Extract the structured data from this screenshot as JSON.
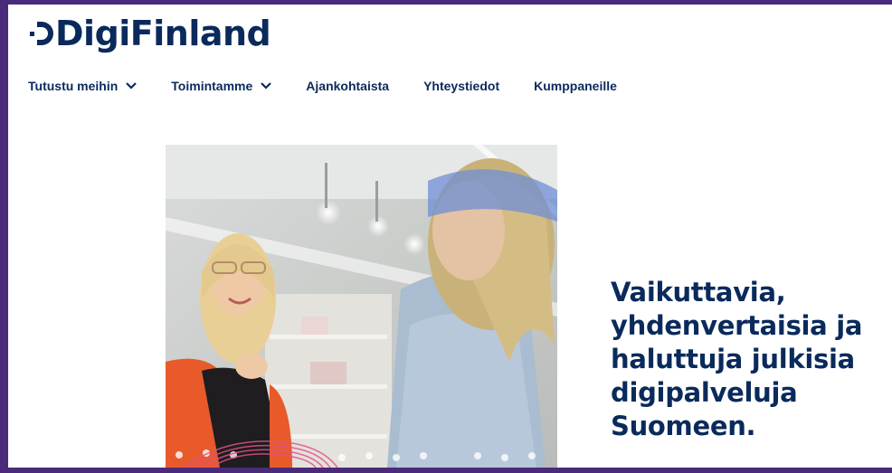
{
  "brand": {
    "name": "DigiFinland",
    "logo_icon": "digifinland-d-mark",
    "color": "#0a2a5c"
  },
  "nav": {
    "items": [
      {
        "label": "Tutustu meihin",
        "dropdown": true
      },
      {
        "label": "Toimintamme",
        "dropdown": true
      },
      {
        "label": "Ajankohtaista",
        "dropdown": false
      },
      {
        "label": "Yhteystiedot",
        "dropdown": false
      },
      {
        "label": "Kumppaneille",
        "dropdown": false
      }
    ]
  },
  "hero": {
    "title_lines": [
      "Vaikuttavia,",
      "yhdenvertaisia ja",
      "haluttuja julkisia",
      "digipalveluja",
      "Suomeen."
    ],
    "image": "two-women-talking-office-photo"
  },
  "colors": {
    "frame": "#4a2a7a",
    "text": "#0a2a5c",
    "background": "#ffffff"
  }
}
